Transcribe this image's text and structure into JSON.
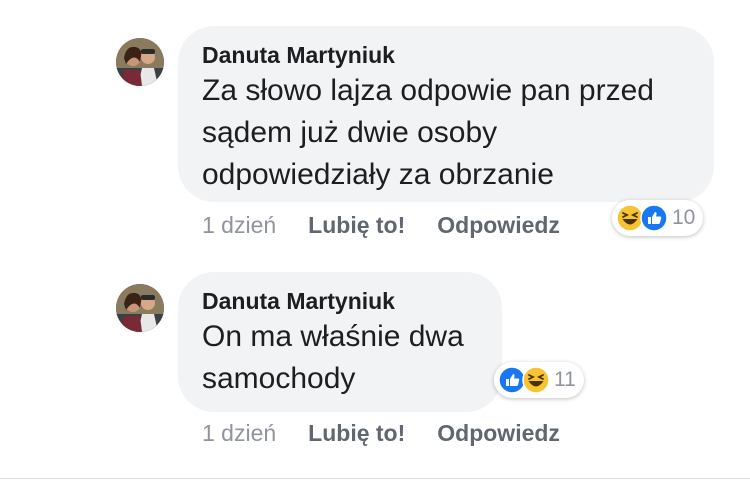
{
  "comments": [
    {
      "author": "Danuta Martyniuk",
      "lines": [
        "Za słowo lajza odpowie pan przed",
        "sądem już dwie osoby",
        "odpowiedziały za obrzanie"
      ],
      "time": "1 dzień",
      "like_label": "Lubię to!",
      "reply_label": "Odpowiedz",
      "reactions": [
        "haha",
        "like"
      ],
      "reaction_count": "10"
    },
    {
      "author": "Danuta Martyniuk",
      "lines": [
        "On ma właśnie dwa",
        "samochody"
      ],
      "time": "1 dzień",
      "like_label": "Lubię to!",
      "reply_label": "Odpowiedz",
      "reactions": [
        "like",
        "haha"
      ],
      "reaction_count": "11"
    }
  ],
  "colors": {
    "bubble": "#f2f3f5",
    "like_blue": "#1877f2",
    "haha_yellow": "#f7c233",
    "meta_gray": "#90949c"
  }
}
